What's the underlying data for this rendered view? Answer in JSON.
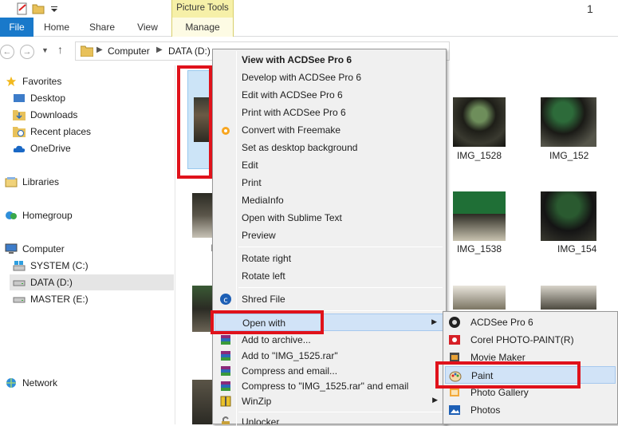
{
  "ribbon": {
    "context_group": "Picture Tools",
    "title_fragment": "1",
    "tabs": [
      "File",
      "Home",
      "Share",
      "View",
      "Manage"
    ]
  },
  "address": {
    "crumbs": [
      "Computer",
      "DATA (D:)"
    ]
  },
  "nav": {
    "favorites": "Favorites",
    "desktop": "Desktop",
    "downloads": "Downloads",
    "recent_places": "Recent places",
    "onedrive": "OneDrive",
    "libraries": "Libraries",
    "homegroup": "Homegroup",
    "computer": "Computer",
    "system_c": "SYSTEM (C:)",
    "data_d": "DATA (D:)",
    "master_e": "MASTER (E:)",
    "network": "Network"
  },
  "files": {
    "captions": [
      "IMG_1528",
      "IMG_152",
      "IMG_1538",
      "IMG_154",
      "I"
    ]
  },
  "context_menu": {
    "view_acdsee": "View with ACDSee Pro 6",
    "develop_acdsee": "Develop with ACDSee Pro 6",
    "edit_acdsee": "Edit with ACDSee Pro 6",
    "print_acdsee": "Print with ACDSee Pro 6",
    "convert_freemake": "Convert with Freemake",
    "set_background": "Set as desktop background",
    "edit": "Edit",
    "print": "Print",
    "mediainfo": "MediaInfo",
    "open_sublime": "Open with Sublime Text",
    "preview": "Preview",
    "rotate_right": "Rotate right",
    "rotate_left": "Rotate left",
    "shred_file": "Shred File",
    "open_with": "Open with",
    "add_archive": "Add to archive...",
    "add_rar": "Add to \"IMG_1525.rar\"",
    "compress_email": "Compress and email...",
    "compress_rar_email": "Compress to \"IMG_1525.rar\" and email",
    "winzip": "WinZip",
    "unlocker": "Unlocker"
  },
  "open_with_submenu": {
    "acdsee": "ACDSee Pro 6",
    "corel": "Corel PHOTO-PAINT(R)",
    "movie_maker": "Movie Maker",
    "paint": "Paint",
    "photo_gallery": "Photo Gallery",
    "photos": "Photos"
  },
  "colors": {
    "file_tab": "#1979ca",
    "context_tab": "#f6f0a8",
    "highlight_box": "#e0121b",
    "menu_hover": "#d1e3f7"
  }
}
